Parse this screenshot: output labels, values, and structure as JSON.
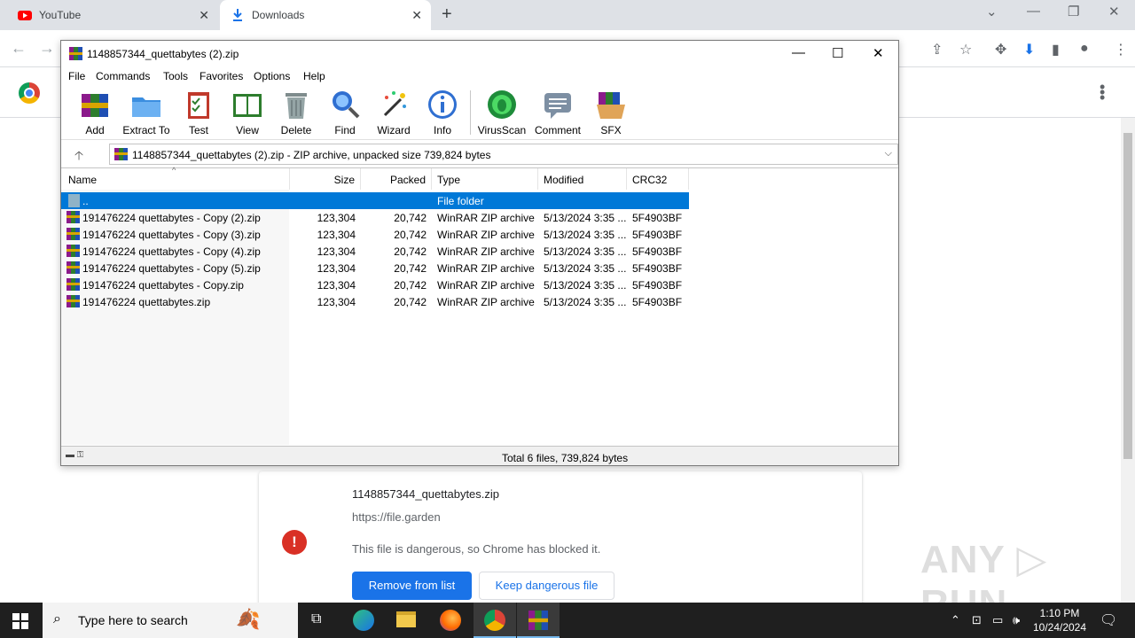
{
  "browser": {
    "tabs": [
      {
        "title": "YouTube",
        "icon": "youtube-icon"
      },
      {
        "title": "Downloads",
        "icon": "download-icon"
      }
    ]
  },
  "winrar": {
    "title": "1148857344_quettabytes (2).zip",
    "menu": [
      "File",
      "Commands",
      "Tools",
      "Favorites",
      "Options",
      "Help"
    ],
    "toolbar": [
      "Add",
      "Extract To",
      "Test",
      "View",
      "Delete",
      "Find",
      "Wizard",
      "Info",
      "VirusScan",
      "Comment",
      "SFX"
    ],
    "address": "1148857344_quettabytes (2).zip - ZIP archive, unpacked size 739,824 bytes",
    "columns": [
      "Name",
      "Size",
      "Packed",
      "Type",
      "Modified",
      "CRC32"
    ],
    "folder_row": {
      "name": "..",
      "type": "File folder"
    },
    "files": [
      {
        "name": "191476224 quettabytes - Copy (2).zip",
        "size": "123,304",
        "packed": "20,742",
        "type": "WinRAR ZIP archive",
        "modified": "5/13/2024 3:35 ...",
        "crc": "5F4903BF"
      },
      {
        "name": "191476224 quettabytes - Copy (3).zip",
        "size": "123,304",
        "packed": "20,742",
        "type": "WinRAR ZIP archive",
        "modified": "5/13/2024 3:35 ...",
        "crc": "5F4903BF"
      },
      {
        "name": "191476224 quettabytes - Copy (4).zip",
        "size": "123,304",
        "packed": "20,742",
        "type": "WinRAR ZIP archive",
        "modified": "5/13/2024 3:35 ...",
        "crc": "5F4903BF"
      },
      {
        "name": "191476224 quettabytes - Copy (5).zip",
        "size": "123,304",
        "packed": "20,742",
        "type": "WinRAR ZIP archive",
        "modified": "5/13/2024 3:35 ...",
        "crc": "5F4903BF"
      },
      {
        "name": "191476224 quettabytes - Copy.zip",
        "size": "123,304",
        "packed": "20,742",
        "type": "WinRAR ZIP archive",
        "modified": "5/13/2024 3:35 ...",
        "crc": "5F4903BF"
      },
      {
        "name": "191476224 quettabytes.zip",
        "size": "123,304",
        "packed": "20,742",
        "type": "WinRAR ZIP archive",
        "modified": "5/13/2024 3:35 ...",
        "crc": "5F4903BF"
      }
    ],
    "status": "Total 6 files, 739,824 bytes"
  },
  "download": {
    "filename": "1148857344_quettabytes.zip",
    "url": "https://file.garden",
    "message": "This file is dangerous, so Chrome has blocked it.",
    "remove_label": "Remove from list",
    "keep_label": "Keep dangerous file"
  },
  "watermark": "ANY RUN",
  "taskbar": {
    "search_placeholder": "Type here to search",
    "time": "1:10 PM",
    "date": "10/24/2024"
  },
  "colors": {
    "accent": "#1a73e8",
    "selection": "#0078d7",
    "danger": "#d93025"
  }
}
